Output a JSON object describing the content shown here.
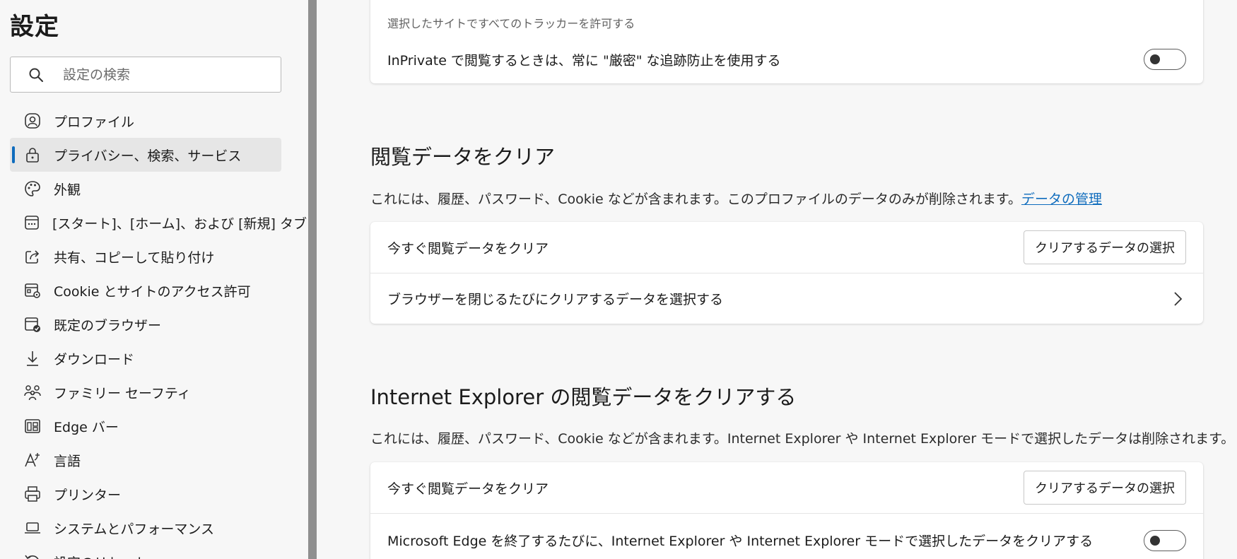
{
  "sidebar": {
    "title": "設定",
    "search": {
      "placeholder": "設定の検索",
      "value": ""
    },
    "items": [
      {
        "label": "プロファイル",
        "icon": "profile-icon"
      },
      {
        "label": "プライバシー、検索、サービス",
        "icon": "lock-icon",
        "active": true
      },
      {
        "label": "外観",
        "icon": "palette-icon"
      },
      {
        "label": "[スタート]、[ホーム]、および [新規] タブ",
        "icon": "new-tab-icon"
      },
      {
        "label": "共有、コピーして貼り付け",
        "icon": "share-icon"
      },
      {
        "label": "Cookie とサイトのアクセス許可",
        "icon": "site-permissions-icon"
      },
      {
        "label": "既定のブラウザー",
        "icon": "default-browser-icon"
      },
      {
        "label": "ダウンロード",
        "icon": "download-icon"
      },
      {
        "label": "ファミリー セーフティ",
        "icon": "family-icon"
      },
      {
        "label": "Edge バー",
        "icon": "edge-bar-icon"
      },
      {
        "label": "言語",
        "icon": "language-icon"
      },
      {
        "label": "プリンター",
        "icon": "printer-icon"
      },
      {
        "label": "システムとパフォーマンス",
        "icon": "laptop-icon"
      },
      {
        "label": "設定のリセット",
        "icon": "reset-icon"
      }
    ]
  },
  "tracking": {
    "exceptions_text": "選択したサイトですべてのトラッカーを許可する",
    "inprivate_label": "InPrivate で閲覧するときは、常に \"厳密\" な追跡防止を使用する",
    "inprivate_toggle": "off"
  },
  "clear_data": {
    "title": "閲覧データをクリア",
    "description": "これには、履歴、パスワード、Cookie などが含まれます。このプロファイルのデータのみが削除されます。",
    "manage_link": "データの管理",
    "clear_now_label": "今すぐ閲覧データをクリア",
    "choose_button": "クリアするデータの選択",
    "on_close_label": "ブラウザーを閉じるたびにクリアするデータを選択する"
  },
  "ie_clear": {
    "title": "Internet Explorer の閲覧データをクリアする",
    "description": "これには、履歴、パスワード、Cookie などが含まれます。Internet Explorer や Internet Explorer モードで選択したデータは削除されます。",
    "clear_now_label": "今すぐ閲覧データをクリア",
    "choose_button": "クリアするデータの選択",
    "on_exit_label": "Microsoft Edge を終了するたびに、Internet Explorer や Internet Explorer モードで選択したデータをクリアする",
    "on_exit_toggle": "off"
  },
  "colors": {
    "accent": "#0f6cbd",
    "page_background": "#f7f7f7",
    "card_background": "#ffffff"
  }
}
